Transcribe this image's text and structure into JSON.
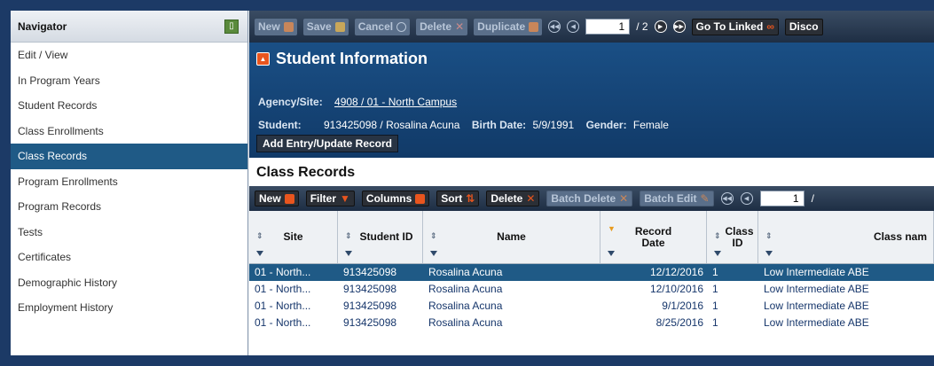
{
  "navigator": {
    "title": "Navigator",
    "items": [
      {
        "label": "Edit / View"
      },
      {
        "label": "In Program Years"
      },
      {
        "label": "Student Records"
      },
      {
        "label": "Class Enrollments"
      },
      {
        "label": "Class Records"
      },
      {
        "label": "Program Enrollments"
      },
      {
        "label": "Program Records"
      },
      {
        "label": "Tests"
      },
      {
        "label": "Certificates"
      },
      {
        "label": "Demographic History"
      },
      {
        "label": "Employment History"
      }
    ],
    "active_item": "Class Records"
  },
  "toolbar": {
    "new": "New",
    "save": "Save",
    "cancel": "Cancel",
    "delete": "Delete",
    "duplicate": "Duplicate",
    "page_value": "1",
    "page_total": "/ 2",
    "go_to_linked": "Go To Linked",
    "discard": "Disco"
  },
  "student_info": {
    "title": "Student Information",
    "agency_label": "Agency/Site:",
    "agency_value": "4908 / 01 - North Campus",
    "student_label": "Student:",
    "student_value": "913425098 / Rosalina Acuna",
    "birth_label": "Birth Date:",
    "birth_value": "5/9/1991",
    "gender_label": "Gender:",
    "gender_value": "Female",
    "add_entry": "Add Entry/Update Record"
  },
  "class_records": {
    "title": "Class Records",
    "toolbar": {
      "new": "New",
      "filter": "Filter",
      "columns": "Columns",
      "sort": "Sort",
      "delete": "Delete",
      "batch_delete": "Batch Delete",
      "batch_edit": "Batch Edit",
      "page_value": "1",
      "page_total": "/"
    },
    "columns": [
      "Site",
      "Student ID",
      "Name",
      "Record Date",
      "Class ID",
      "Class nam"
    ],
    "sorted_column": "Record Date",
    "rows": [
      {
        "site": "01 - North...",
        "student_id": "913425098",
        "name": "Rosalina Acuna",
        "record_date": "12/12/2016",
        "class_id": "1",
        "class_name": "Low Intermediate ABE"
      },
      {
        "site": "01 - North...",
        "student_id": "913425098",
        "name": "Rosalina Acuna",
        "record_date": "12/10/2016",
        "class_id": "1",
        "class_name": "Low Intermediate ABE"
      },
      {
        "site": "01 - North...",
        "student_id": "913425098",
        "name": "Rosalina Acuna",
        "record_date": "9/1/2016",
        "class_id": "1",
        "class_name": "Low Intermediate ABE"
      },
      {
        "site": "01 - North...",
        "student_id": "913425098",
        "name": "Rosalina Acuna",
        "record_date": "8/25/2016",
        "class_id": "1",
        "class_name": "Low Intermediate ABE"
      }
    ],
    "selected_row": 0
  },
  "colors": {
    "accent_blue": "#1f5a86",
    "toolbar_dark": "#1e2e44",
    "link_text": "#16366b",
    "sort_orange": "#e89a1e"
  }
}
